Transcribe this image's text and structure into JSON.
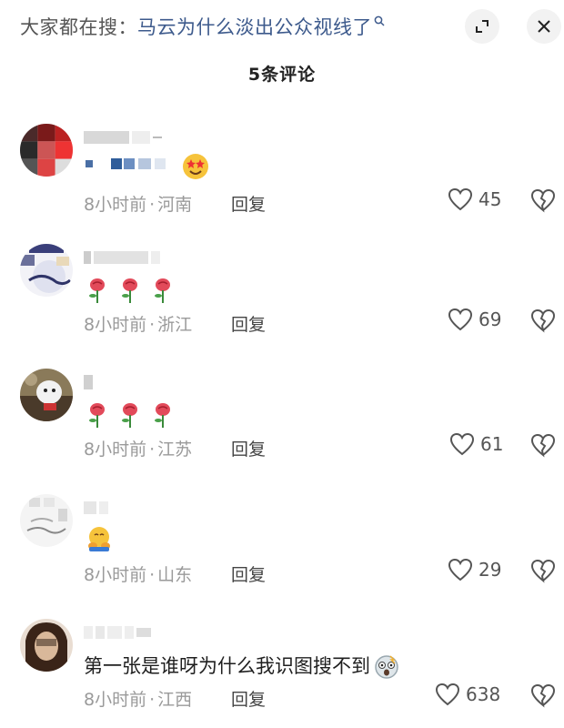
{
  "header": {
    "search_prefix": "大家都在搜：",
    "search_query": "马云为什么淡出公众视线了",
    "comment_count_label": "5条评论"
  },
  "comments": [
    {
      "time": "8小时前",
      "location": "河南",
      "reply_label": "回复",
      "likes": "45",
      "text": "",
      "emojis": [
        "starstruck-face"
      ]
    },
    {
      "time": "8小时前",
      "location": "浙江",
      "reply_label": "回复",
      "likes": "69",
      "text": "",
      "emojis": [
        "rose",
        "rose",
        "rose"
      ]
    },
    {
      "time": "8小时前",
      "location": "江苏",
      "reply_label": "回复",
      "likes": "61",
      "text": "",
      "emojis": [
        "rose",
        "rose",
        "rose"
      ]
    },
    {
      "time": "8小时前",
      "location": "山东",
      "reply_label": "回复",
      "likes": "29",
      "text": "",
      "emojis": [
        "hugging-face"
      ]
    },
    {
      "time": "8小时前",
      "location": "江西",
      "reply_label": "回复",
      "likes": "638",
      "text": "第一张是谁呀为什么我识图搜不到",
      "emojis": [
        "shocked-face"
      ]
    }
  ],
  "colors": {
    "accent_query": "#3d5a8c",
    "meta_gray": "#9a9a9a"
  }
}
